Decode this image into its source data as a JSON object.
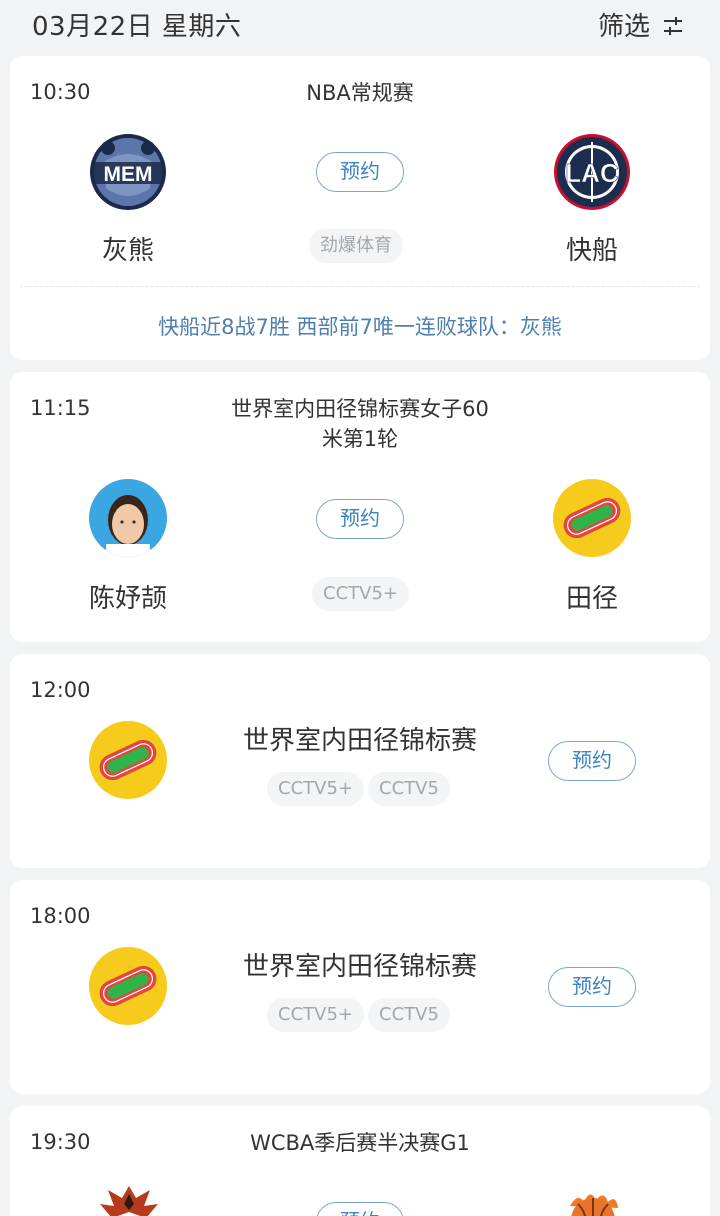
{
  "header": {
    "date": "03月22日 星期六",
    "filter_label": "筛选",
    "filter_icon": "filter-sliders-icon"
  },
  "matches": [
    {
      "time": "10:30",
      "title": "NBA常规赛",
      "home": {
        "name": "灰熊",
        "logo": "memphis-grizzlies-logo",
        "logo_text": "MEM"
      },
      "away": {
        "name": "快船",
        "logo": "la-clippers-logo",
        "logo_text": "LAC"
      },
      "book_label": "预约",
      "channels": [
        "劲爆体育"
      ],
      "note": "快船近8战7胜 西部前7唯一连败球队：灰熊"
    },
    {
      "time": "11:15",
      "title_line1": "世界室内田径锦标赛女子60",
      "title_line2": "米第1轮",
      "home": {
        "name": "陈妤颉",
        "logo": "athlete-avatar"
      },
      "away": {
        "name": "田径",
        "logo": "athletics-track-icon"
      },
      "book_label": "预约",
      "channels": [
        "CCTV5+"
      ]
    },
    {
      "time": "12:00",
      "title": "世界室内田径锦标赛",
      "logo": "athletics-track-icon",
      "book_label": "预约",
      "channels": [
        "CCTV5+",
        "CCTV5"
      ]
    },
    {
      "time": "18:00",
      "title": "世界室内田径锦标赛",
      "logo": "athletics-track-icon",
      "book_label": "预约",
      "channels": [
        "CCTV5+",
        "CCTV5"
      ]
    },
    {
      "time": "19:30",
      "title": "WCBA季后赛半决赛G1",
      "home": {
        "logo": "phoenix-team-logo"
      },
      "away": {
        "logo": "basketball-flame-logo"
      },
      "book_label": "预约"
    }
  ],
  "colors": {
    "background": "#f2f3f5",
    "card": "#ffffff",
    "accent_blue": "#3d84c2",
    "note_blue": "#4f7fae",
    "track_yellow": "#f7cb1c",
    "track_red": "#e2463e",
    "track_green": "#2fb44a",
    "grizzlies_navy": "#1b2a4a",
    "clippers_red": "#c8102e"
  }
}
